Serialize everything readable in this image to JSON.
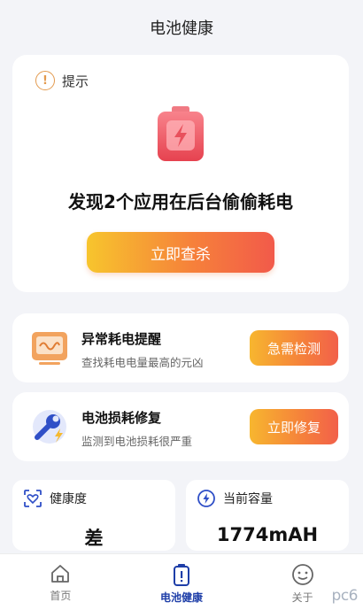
{
  "header": {
    "title": "电池健康"
  },
  "tip": {
    "icon": "info-circle-icon",
    "label": "提示",
    "illustration": "battery-charging-icon",
    "headline": "发现2个应用在后台偷偷耗电",
    "button_label": "立即查杀"
  },
  "features": [
    {
      "icon": "monitor-wave-icon",
      "title": "异常耗电提醒",
      "subtitle": "查找耗电电量最高的元凶",
      "button_label": "急需检测"
    },
    {
      "icon": "wrench-battery-icon",
      "title": "电池损耗修复",
      "subtitle": "监测到电池损耗很严重",
      "button_label": "立即修复"
    }
  ],
  "stats": [
    {
      "icon": "heart-scan-icon",
      "label": "健康度",
      "value": "差"
    },
    {
      "icon": "lightning-circle-icon",
      "label": "当前容量",
      "value": "1774mAH"
    }
  ],
  "nav": {
    "items": [
      {
        "icon": "home-icon",
        "label": "首页"
      },
      {
        "icon": "battery-icon",
        "label": "电池健康"
      },
      {
        "icon": "smiley-user-icon",
        "label": "关于"
      }
    ],
    "active_index": 1
  },
  "watermark": "pc6",
  "colors": {
    "background": "#f3f4f8",
    "accent_orange": "#f5803b",
    "accent_yellow": "#f7c52d",
    "nav_active": "#1e3ea8",
    "battery_red": "#ef5a66"
  }
}
